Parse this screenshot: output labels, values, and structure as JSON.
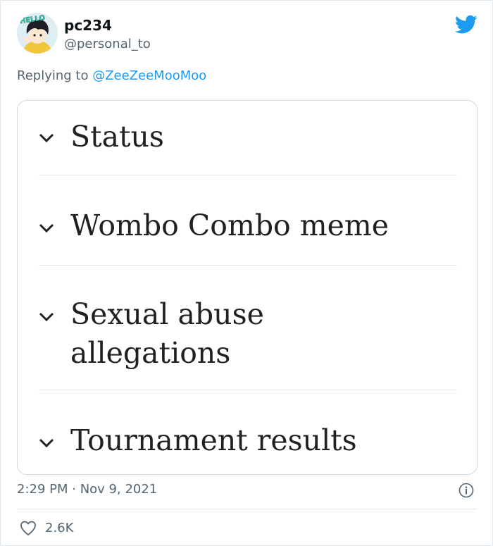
{
  "user": {
    "display_name": "pc234",
    "handle": "@personal_to",
    "avatar_badge_text": "HELLO"
  },
  "reply": {
    "prefix": "Replying to ",
    "mention": "@ZeeZeeMooMoo"
  },
  "card": {
    "sections": [
      {
        "label": "Status"
      },
      {
        "label": "Wombo Combo meme"
      },
      {
        "label_line1": "Sexual abuse",
        "label_line2": "allegations"
      },
      {
        "label": "Tournament results"
      }
    ]
  },
  "meta": {
    "timestamp": "2:29 PM · Nov 9, 2021",
    "likes": "2.6K"
  },
  "colors": {
    "twitter_blue": "#1d9bf0",
    "mention": "#1d9bf0",
    "muted": "#536471"
  },
  "icons": [
    "twitter-bird-icon",
    "chevron-down-icon",
    "info-icon",
    "heart-icon"
  ]
}
